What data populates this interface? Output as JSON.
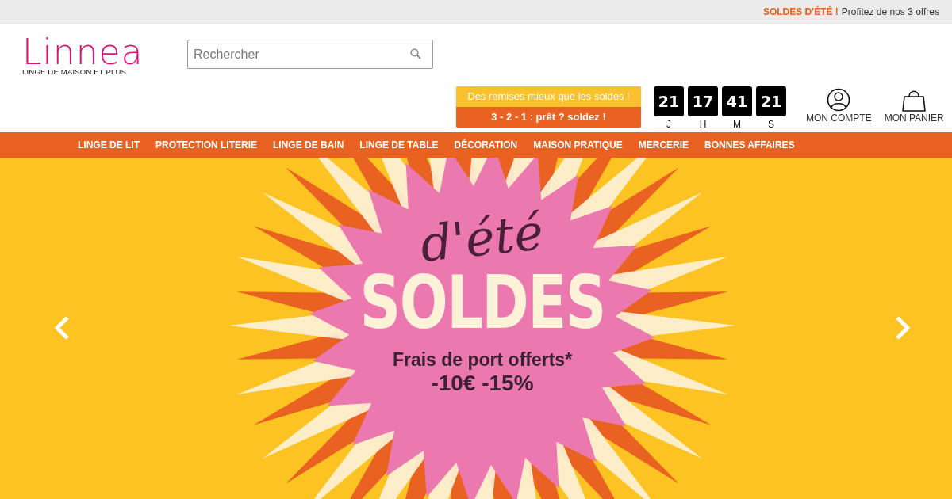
{
  "top_bar": {
    "highlight": "SOLDES D'ÉTÉ !",
    "text": "Profitez de nos 3 offres"
  },
  "logo": {
    "name": "Linnea",
    "tagline": "LINGE DE MAISON ET PLUS"
  },
  "search": {
    "placeholder": "Rechercher"
  },
  "promo": {
    "line1": "Des remises mieux que les soldes !",
    "line2": "3 - 2 - 1 : prêt ? soldez !"
  },
  "countdown": [
    {
      "value": "21",
      "unit": "J"
    },
    {
      "value": "17",
      "unit": "H"
    },
    {
      "value": "41",
      "unit": "M"
    },
    {
      "value": "21",
      "unit": "S"
    }
  ],
  "account": {
    "label": "MON COMPTE"
  },
  "cart": {
    "label": "MON PANIER"
  },
  "nav": [
    "LINGE DE LIT",
    "PROTECTION LITERIE",
    "LINGE DE BAIN",
    "LINGE DE TABLE",
    "DÉCORATION",
    "MAISON PRATIQUE",
    "MERCERIE",
    "BONNES AFFAIRES"
  ],
  "hero": {
    "script": "d'été",
    "title": "SOLDES",
    "line1": "Frais de port offerts*",
    "line2": "-10€ -15%"
  }
}
